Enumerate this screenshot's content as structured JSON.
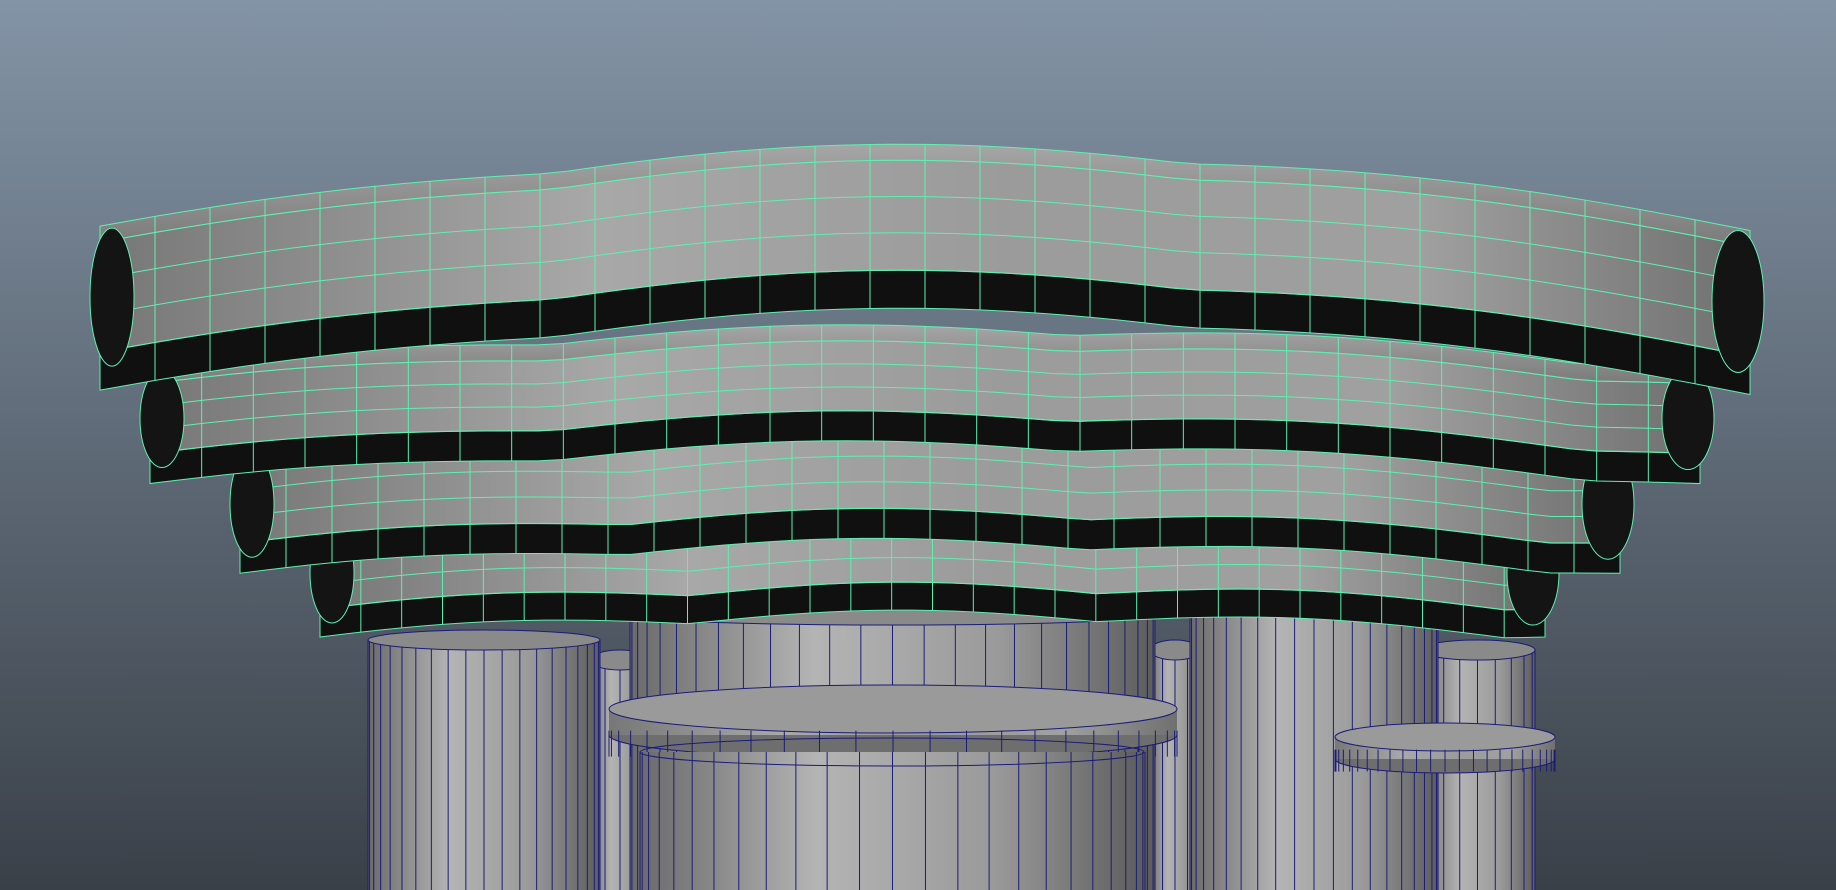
{
  "viewport": {
    "mode": "wireframe-on-shaded",
    "background": {
      "top": "#8394a6",
      "bottom": "#3a4048"
    }
  },
  "colors": {
    "selected_wire": "#5ef0b0",
    "unselected_wire": "#1a1c78",
    "shade_light": "#b0b0b0",
    "shade_mid": "#8c8c8c",
    "shade_dark": "#5a5a5a",
    "shadow": "#101010"
  },
  "scene": {
    "selected_object": "column-capital-mesh",
    "objects": [
      {
        "name": "capital-tier-1",
        "selected": true
      },
      {
        "name": "capital-tier-2",
        "selected": true
      },
      {
        "name": "capital-tier-3",
        "selected": true
      },
      {
        "name": "capital-tier-4",
        "selected": true
      },
      {
        "name": "column-shaft-left",
        "selected": false
      },
      {
        "name": "column-shaft-center",
        "selected": false
      },
      {
        "name": "column-shaft-right",
        "selected": false
      },
      {
        "name": "column-shaft-far-right",
        "selected": false
      },
      {
        "name": "column-ring-center",
        "selected": false
      },
      {
        "name": "column-ring-right",
        "selected": false
      }
    ]
  }
}
